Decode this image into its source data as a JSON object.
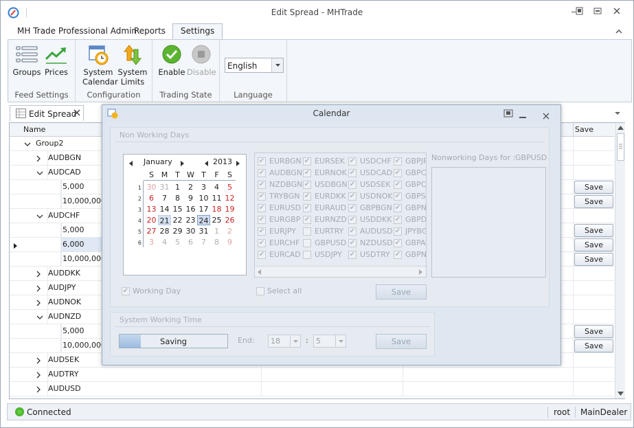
{
  "window": {
    "title": "Edit Spread - MHTrade"
  },
  "ribbon_tabs": [
    "MH Trade Professional Admin",
    "Reports",
    "Settings"
  ],
  "groups": {
    "feed": {
      "label": "Feed Settings",
      "groups_btn": "Groups",
      "prices_btn": "Prices"
    },
    "config": {
      "label": "Configuration",
      "sys_cal_1": "System",
      "sys_cal_2": "Calendar",
      "sys_lim_1": "System",
      "sys_lim_2": "Limits"
    },
    "trading": {
      "label": "Trading State",
      "enable_btn": "Enable",
      "disable_btn": "Disable"
    },
    "language": {
      "label": "Language",
      "value": "English"
    }
  },
  "doc_tab": "Edit Spread",
  "grid": {
    "col_name": "Name",
    "col_save": "Save",
    "save_label": "Save",
    "rows": [
      {
        "text": "Group2",
        "level": 0,
        "exp": "down",
        "save": false
      },
      {
        "text": "AUDBGN",
        "level": 1,
        "exp": "right",
        "save": false
      },
      {
        "text": "AUDCAD",
        "level": 1,
        "exp": "down",
        "save": false
      },
      {
        "text": "5,000",
        "level": 2,
        "exp": "",
        "save": true
      },
      {
        "text": "10,000,000",
        "level": 2,
        "exp": "",
        "save": true
      },
      {
        "text": "AUDCHF",
        "level": 1,
        "exp": "down",
        "save": false
      },
      {
        "text": "5,000",
        "level": 2,
        "exp": "",
        "save": true
      },
      {
        "text": "6,000",
        "level": 2,
        "exp": "",
        "save": true,
        "current": true
      },
      {
        "text": "10,000,000",
        "level": 2,
        "exp": "",
        "save": true
      },
      {
        "text": "AUDDKK",
        "level": 1,
        "exp": "right",
        "save": false
      },
      {
        "text": "AUDJPY",
        "level": 1,
        "exp": "right",
        "save": false
      },
      {
        "text": "AUDNOK",
        "level": 1,
        "exp": "right",
        "save": false
      },
      {
        "text": "AUDNZD",
        "level": 1,
        "exp": "down",
        "save": false
      },
      {
        "text": "5,000",
        "level": 2,
        "exp": "",
        "save": true
      },
      {
        "text": "10,000,000",
        "level": 2,
        "exp": "",
        "save": true
      },
      {
        "text": "AUDSEK",
        "level": 1,
        "exp": "right",
        "save": false
      },
      {
        "text": "AUDTRY",
        "level": 1,
        "exp": "right",
        "save": false
      },
      {
        "text": "AUDUSD",
        "level": 1,
        "exp": "right",
        "save": false
      }
    ]
  },
  "status": {
    "connection": "Connected",
    "user": "root",
    "dealer": "MainDealer"
  },
  "dialog": {
    "title": "Calendar",
    "nwd_section": "Non Working Days",
    "calendar": {
      "month": "January",
      "year": "2013",
      "weekdays": [
        "S",
        "M",
        "T",
        "W",
        "T",
        "F",
        "S"
      ],
      "week_numbers": [
        "1",
        "2",
        "3",
        "4",
        "5",
        "6"
      ],
      "days": [
        [
          "30",
          "31",
          "1",
          "2",
          "3",
          "4",
          "5"
        ],
        [
          "6",
          "7",
          "8",
          "9",
          "10",
          "11",
          "12"
        ],
        [
          "13",
          "14",
          "15",
          "16",
          "17",
          "18",
          "19"
        ],
        [
          "20",
          "21",
          "22",
          "23",
          "24",
          "25",
          "26"
        ],
        [
          "27",
          "28",
          "29",
          "30",
          "31",
          "1",
          "2"
        ],
        [
          "3",
          "4",
          "5",
          "6",
          "7",
          "8",
          "9"
        ]
      ],
      "selected_day": "21",
      "today_day": "24"
    },
    "currencies": [
      [
        "EURBGN",
        "EURSEK",
        "USDCHF",
        "GBPJPY"
      ],
      [
        "AUDBGN",
        "EURNOK",
        "USDCAD",
        "GBPCHF"
      ],
      [
        "NZDBGN",
        "USDBGN",
        "USDSEK",
        "GBPCAD"
      ],
      [
        "TRYBGN",
        "EURDKK",
        "USDNOK",
        "GBPSEK"
      ],
      [
        "EURUSD",
        "EURAUD",
        "GBPBGN",
        "GBPNOK"
      ],
      [
        "EURGBP",
        "EURNZD",
        "USDDKK",
        "GBPDKK"
      ],
      [
        "EURJPY",
        "EURTRY",
        "AUDUSD",
        "JPYBGN"
      ],
      [
        "EURCHF",
        "GBPUSD",
        "NZDUSD",
        "GBPAUD"
      ],
      [
        "EURCAD",
        "USDJPY",
        "USDTRY",
        "GBPNZD"
      ]
    ],
    "checked": [
      [
        true,
        true,
        true,
        true
      ],
      [
        true,
        true,
        true,
        true
      ],
      [
        true,
        true,
        true,
        true
      ],
      [
        true,
        true,
        true,
        true
      ],
      [
        true,
        true,
        true,
        true
      ],
      [
        true,
        true,
        true,
        true
      ],
      [
        true,
        false,
        true,
        true
      ],
      [
        true,
        false,
        true,
        true
      ],
      [
        true,
        false,
        true,
        true
      ]
    ],
    "nonworking_for_label": "Nonworking Days for :",
    "nonworking_for_value": "GBPUSD",
    "working_day": "Working Day",
    "select_all": "Select all",
    "save": "Save",
    "swt_section": "System Working Time",
    "saving": "Saving",
    "saving_progress": 0.2,
    "end_label": "End:",
    "end_hour": "18",
    "end_min": "5",
    "colon": ":"
  }
}
